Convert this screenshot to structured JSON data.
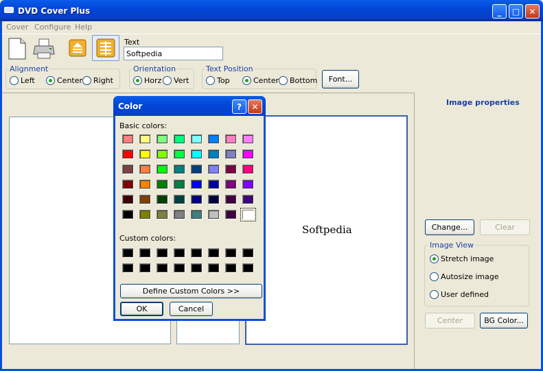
{
  "window": {
    "title": "DVD Cover Plus",
    "min": "_",
    "max": "□",
    "close": "✕"
  },
  "menu": [
    "Cover",
    "Configure",
    "Help"
  ],
  "toolbar": {
    "text_label": "Text",
    "text_value": "Softpedia",
    "alignment": {
      "title": "Alignment",
      "options": [
        "Left",
        "Center",
        "Right"
      ],
      "selected": "Center"
    },
    "orientation": {
      "title": "Orientation",
      "options": [
        "Horz",
        "Vert"
      ],
      "selected": "Horz"
    },
    "text_position": {
      "title": "Text Position",
      "options": [
        "Top",
        "Center",
        "Bottom"
      ],
      "selected": "Center"
    },
    "font_button": "Font..."
  },
  "preview": {
    "text": "Softpedia"
  },
  "right_panel": {
    "title": "Image properties",
    "change_button": "Change...",
    "clear_button": "Clear",
    "image_view": {
      "title": "Image View",
      "options": [
        "Stretch image",
        "Autosize image",
        "User defined"
      ],
      "selected": "Stretch image"
    },
    "center_button": "Center",
    "bg_color_button": "BG Color..."
  },
  "color_dialog": {
    "title": "Color",
    "help": "?",
    "close": "✕",
    "basic_label": "Basic colors:",
    "custom_label": "Custom colors:",
    "basic_colors": [
      [
        "#ff8080",
        "#ffff80",
        "#80ff80",
        "#00ff80",
        "#80ffff",
        "#0080ff",
        "#ff80c0",
        "#ff80ff"
      ],
      [
        "#ff0000",
        "#ffff00",
        "#80ff00",
        "#00ff40",
        "#00ffff",
        "#0080c0",
        "#8080c0",
        "#ff00ff"
      ],
      [
        "#804040",
        "#ff8040",
        "#00ff00",
        "#008080",
        "#004080",
        "#8080ff",
        "#800040",
        "#ff0080"
      ],
      [
        "#800000",
        "#ff8000",
        "#008000",
        "#008040",
        "#0000ff",
        "#0000a0",
        "#800080",
        "#8000ff"
      ],
      [
        "#400000",
        "#804000",
        "#004000",
        "#004040",
        "#000080",
        "#000040",
        "#400040",
        "#400080"
      ],
      [
        "#000000",
        "#808000",
        "#808040",
        "#808080",
        "#408080",
        "#c0c0c0",
        "#400040",
        "#ffffff"
      ]
    ],
    "custom_colors": [
      [
        "#000000",
        "#000000",
        "#000000",
        "#000000",
        "#000000",
        "#000000",
        "#000000",
        "#000000"
      ],
      [
        "#000000",
        "#000000",
        "#000000",
        "#000000",
        "#000000",
        "#000000",
        "#000000",
        "#000000"
      ]
    ],
    "define_button": "Define Custom Colors >>",
    "ok_button": "OK",
    "cancel_button": "Cancel"
  }
}
